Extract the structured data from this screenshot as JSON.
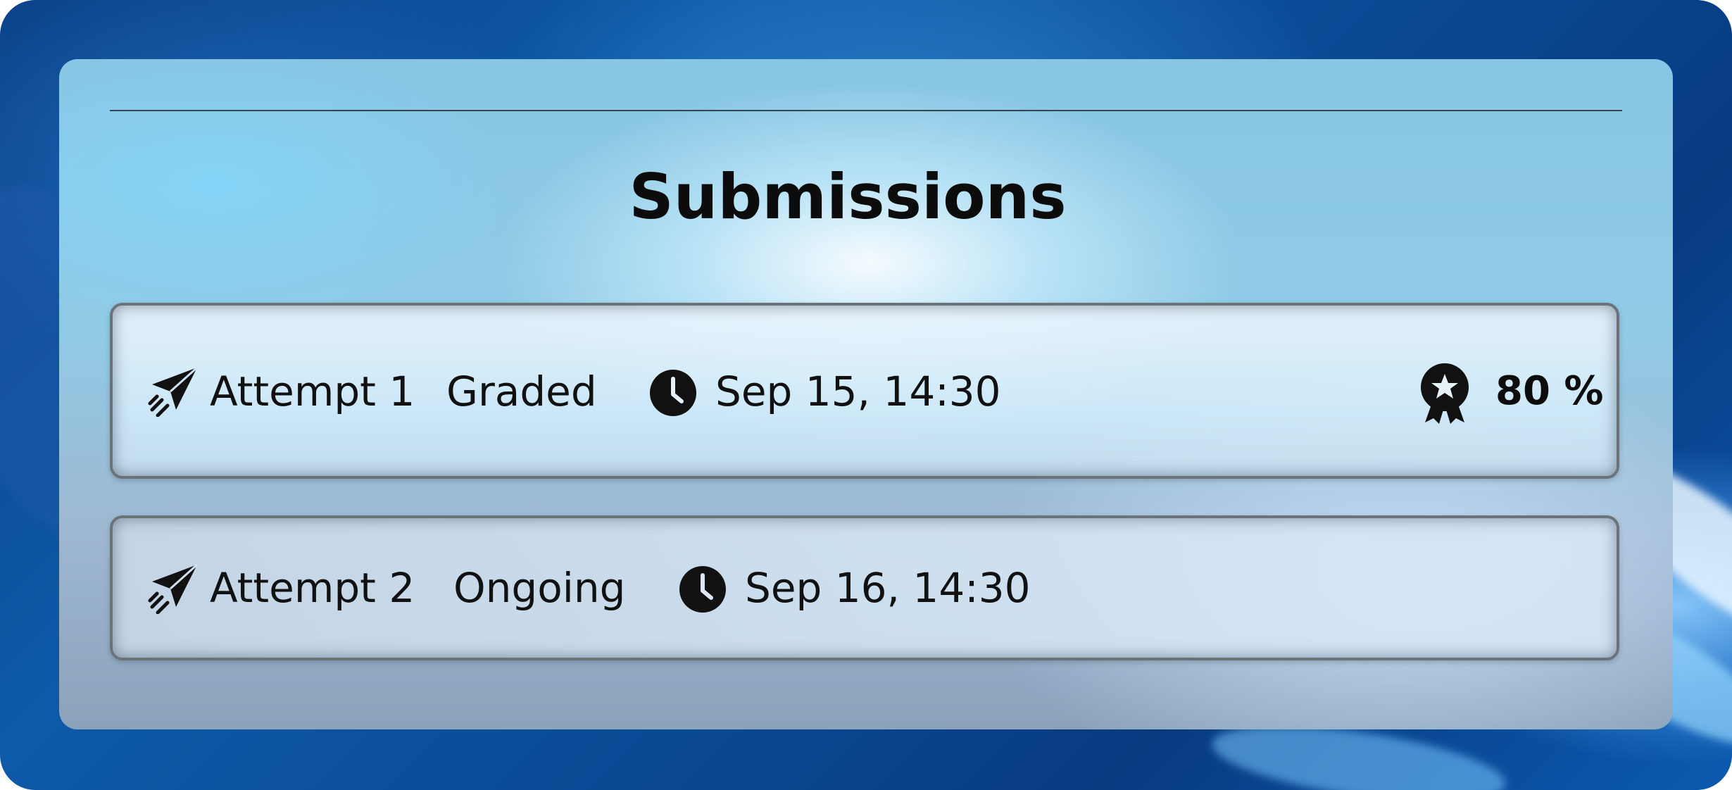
{
  "panel": {
    "title": "Submissions"
  },
  "submissions": [
    {
      "attempt_label": "Attempt 1",
      "status": "Graded",
      "date": "Sep 15, 14:30",
      "score": "80 %",
      "icons": {
        "attempt": "paper-plane-icon",
        "time": "clock-icon",
        "score": "award-badge-icon"
      }
    },
    {
      "attempt_label": "Attempt 2",
      "status": "Ongoing",
      "date": "Sep 16, 14:30",
      "icons": {
        "attempt": "paper-plane-icon",
        "time": "clock-icon"
      }
    }
  ],
  "colors": {
    "text": "#111111",
    "card_border": "#6b737a",
    "divider": "#35474f"
  }
}
